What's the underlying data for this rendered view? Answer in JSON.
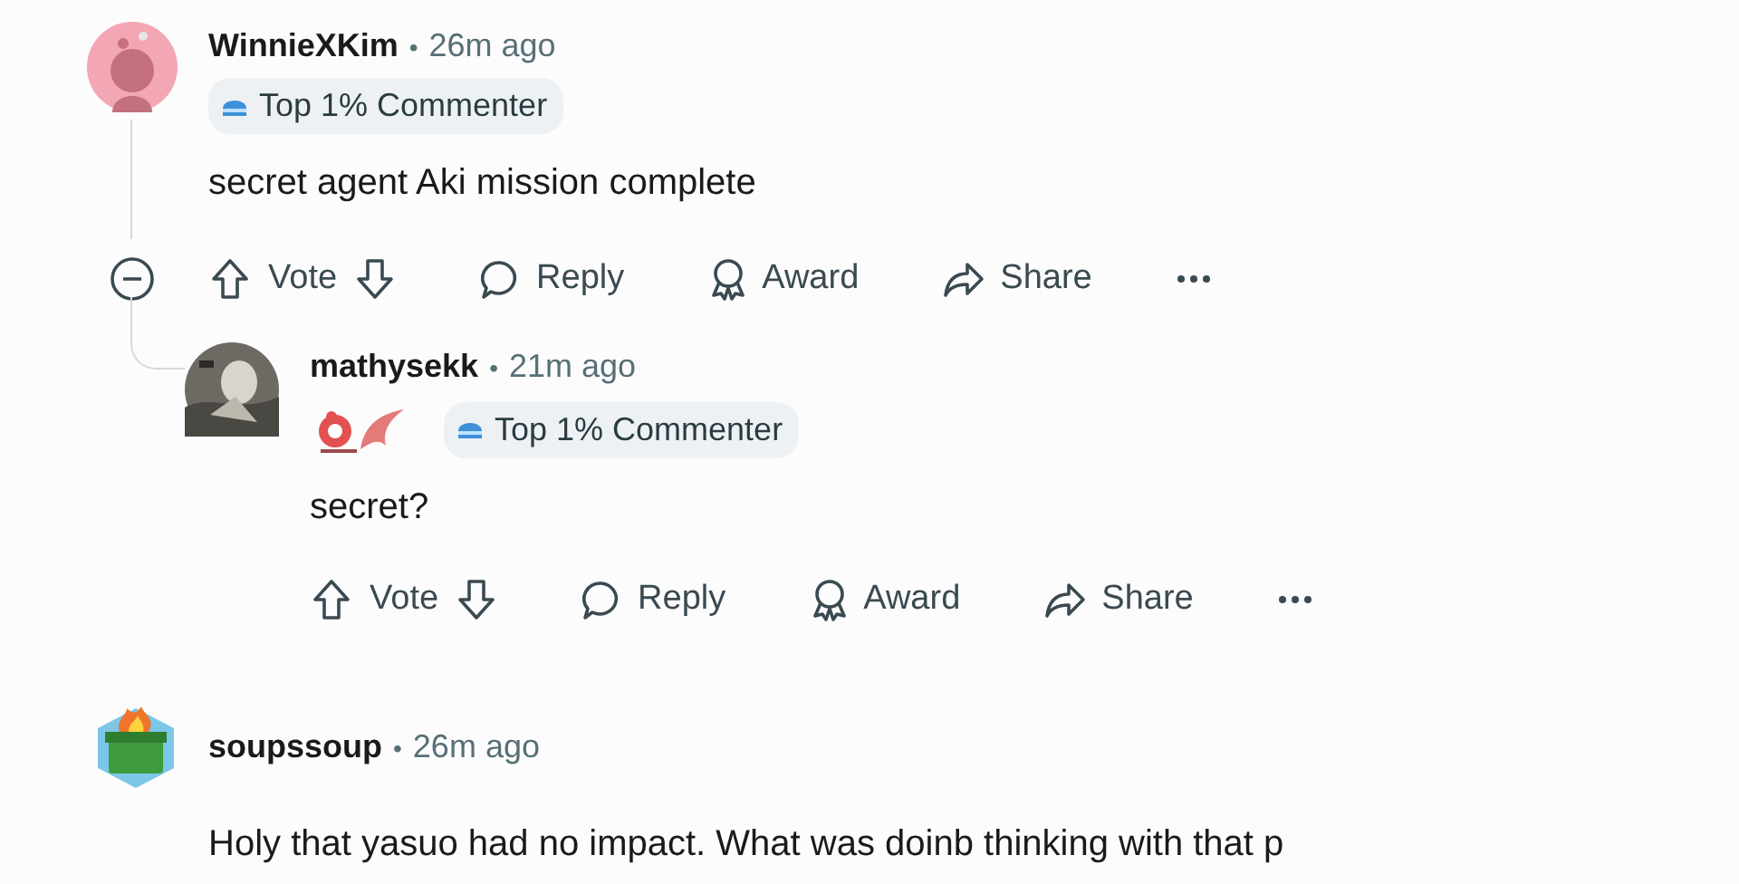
{
  "comments": [
    {
      "author": "WinnieXKim",
      "separator": "•",
      "time": "26m ago",
      "avatar": {
        "kind": "snoo"
      },
      "badges": [
        {
          "kind": "achievement",
          "label": "Top 1% Commenter"
        }
      ],
      "text": "secret agent Aki mission complete",
      "collapse_control": true,
      "actions": [
        "Vote",
        "Reply",
        "Award",
        "Share"
      ],
      "children": [
        {
          "author": "mathysekk",
          "separator": "•",
          "time": "21m ago",
          "badges": [
            {
              "kind": "image-flair"
            },
            {
              "kind": "achievement",
              "label": "Top 1% Commenter"
            }
          ],
          "text": "secret?",
          "collapse_control": false,
          "actions": [
            "Vote",
            "Reply",
            "Award",
            "Share"
          ]
        }
      ]
    },
    {
      "author": "soupssoup",
      "separator": "•",
      "time": "26m ago",
      "avatar": {
        "kind": "dumpster"
      },
      "text": "Holy that yasuo had no impact. What was doinb thinking with that p",
      "collapse_control": false
    }
  ]
}
